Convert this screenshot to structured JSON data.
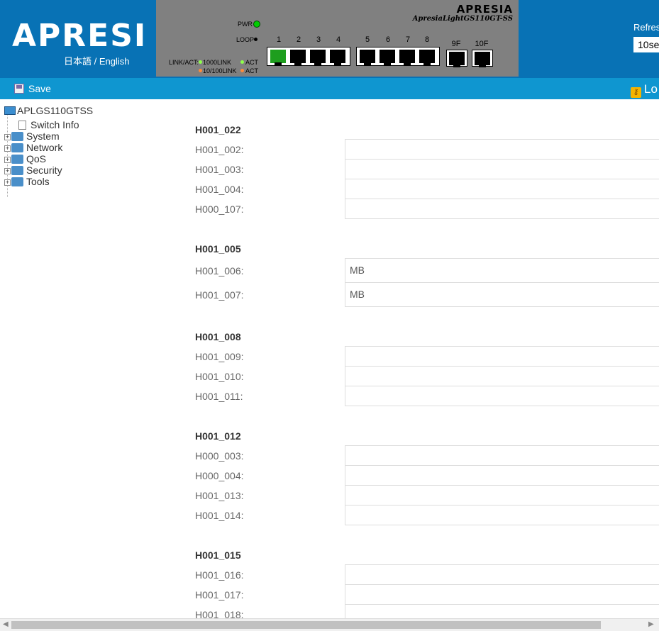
{
  "header": {
    "logo_text": "APRESI",
    "lang_ja": "日本語",
    "lang_sep": "/",
    "lang_en": "English",
    "refresh_label": "Refres",
    "refresh_value": "10se"
  },
  "panel": {
    "brand": "APRESIA",
    "model": "ApresiaLightGS110GT-SS",
    "pwr_label": "PWR",
    "loop_label": "LOOP",
    "link_act_label": "LINK/ACT:",
    "link_1000": "1000LINK",
    "link_10_100": "10/100LINK",
    "act_label": "ACT",
    "ports": [
      "1",
      "2",
      "3",
      "4",
      "5",
      "6",
      "7",
      "8"
    ],
    "sfp_ports": [
      "9F",
      "10F"
    ],
    "active_port": "1",
    "colors": {
      "pwr_led": "#00cc00",
      "link_1000": "#8fff4a",
      "link_10_100": "#ff8a3a",
      "active_port": "#1e9e1e"
    }
  },
  "toolbar": {
    "save_label": "Save",
    "logout_label": "Lo"
  },
  "tree": {
    "root": "APLGS110GTSS",
    "switch_info": "Switch Info",
    "items": [
      "System",
      "Network",
      "QoS",
      "Security",
      "Tools"
    ]
  },
  "content": {
    "sections": [
      {
        "title": "H001_022",
        "rows": [
          {
            "label": "H001_002:",
            "value": ""
          },
          {
            "label": "H001_003:",
            "value": ""
          },
          {
            "label": "H001_004:",
            "value": ""
          },
          {
            "label": "H000_107:",
            "value": ""
          }
        ]
      },
      {
        "title": "H001_005",
        "rows": [
          {
            "label": "H001_006:",
            "value": "MB"
          },
          {
            "label": "H001_007:",
            "value": "MB"
          }
        ]
      },
      {
        "title": "H001_008",
        "rows": [
          {
            "label": "H001_009:",
            "value": ""
          },
          {
            "label": "H001_010:",
            "value": ""
          },
          {
            "label": "H001_011:",
            "value": ""
          }
        ]
      },
      {
        "title": "H001_012",
        "rows": [
          {
            "label": "H000_003:",
            "value": ""
          },
          {
            "label": "H000_004:",
            "value": ""
          },
          {
            "label": "H001_013:",
            "value": ""
          },
          {
            "label": "H001_014:",
            "value": ""
          }
        ]
      },
      {
        "title": "H001_015",
        "rows": [
          {
            "label": "H001_016:",
            "value": ""
          },
          {
            "label": "H001_017:",
            "value": ""
          },
          {
            "label": "H001_018:",
            "value": ""
          }
        ]
      }
    ]
  }
}
